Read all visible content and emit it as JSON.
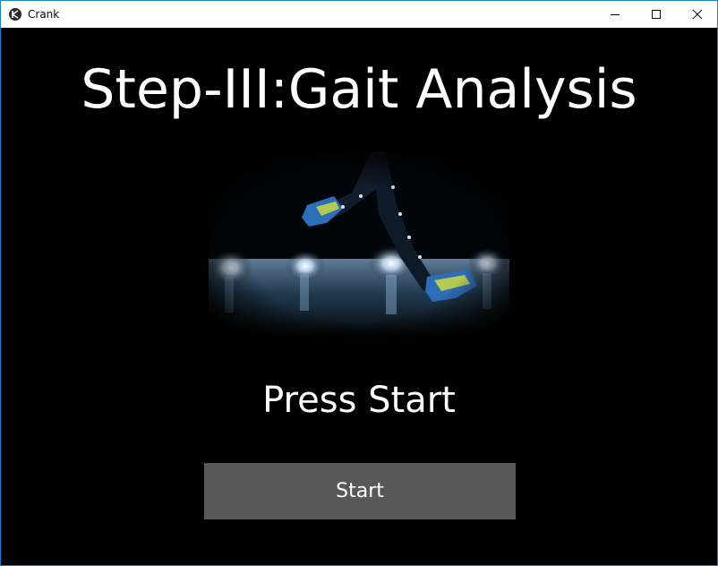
{
  "window": {
    "title": "Crank",
    "app_icon": "kivy-logo-icon",
    "controls": {
      "minimize_icon": "minimize-icon",
      "maximize_icon": "maximize-icon",
      "close_icon": "close-icon"
    }
  },
  "main": {
    "heading": "Step-III:Gait Analysis",
    "hero_image": "running-legs-on-lit-track-image",
    "subheading": "Press Start",
    "start_button_label": "Start"
  },
  "colors": {
    "background": "#000000",
    "text": "#ffffff",
    "button_bg": "#585858",
    "window_border": "#1e7fd1"
  }
}
